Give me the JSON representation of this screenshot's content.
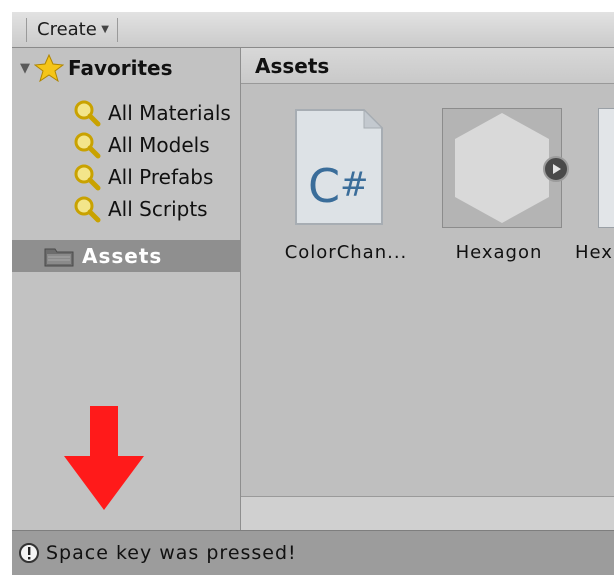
{
  "toolbar": {
    "create_label": "Create",
    "caret": "▼"
  },
  "sidebar": {
    "favorites_label": "Favorites",
    "favorites": [
      {
        "label": "All Materials",
        "icon": "magnifier-icon"
      },
      {
        "label": "All Models",
        "icon": "magnifier-icon"
      },
      {
        "label": "All Prefabs",
        "icon": "magnifier-icon"
      },
      {
        "label": "All Scripts",
        "icon": "magnifier-icon"
      }
    ],
    "assets_label": "Assets"
  },
  "main": {
    "header_title": "Assets",
    "items": [
      {
        "name": "ColorChan...",
        "icon": "csharp-script-icon"
      },
      {
        "name": "Hexagon",
        "icon": "hexagon-sprite-icon"
      },
      {
        "name": "Hex",
        "icon": "partial-asset-icon"
      }
    ]
  },
  "status": {
    "message": "Space key was pressed!",
    "icon": "info-icon"
  },
  "annotation": {
    "icon": "red-arrow-down-icon",
    "color": "#ff0000"
  },
  "colors": {
    "selection": "#8f8f8f",
    "panel": "#c2c2c2",
    "status_bar": "#9c9c9c"
  }
}
